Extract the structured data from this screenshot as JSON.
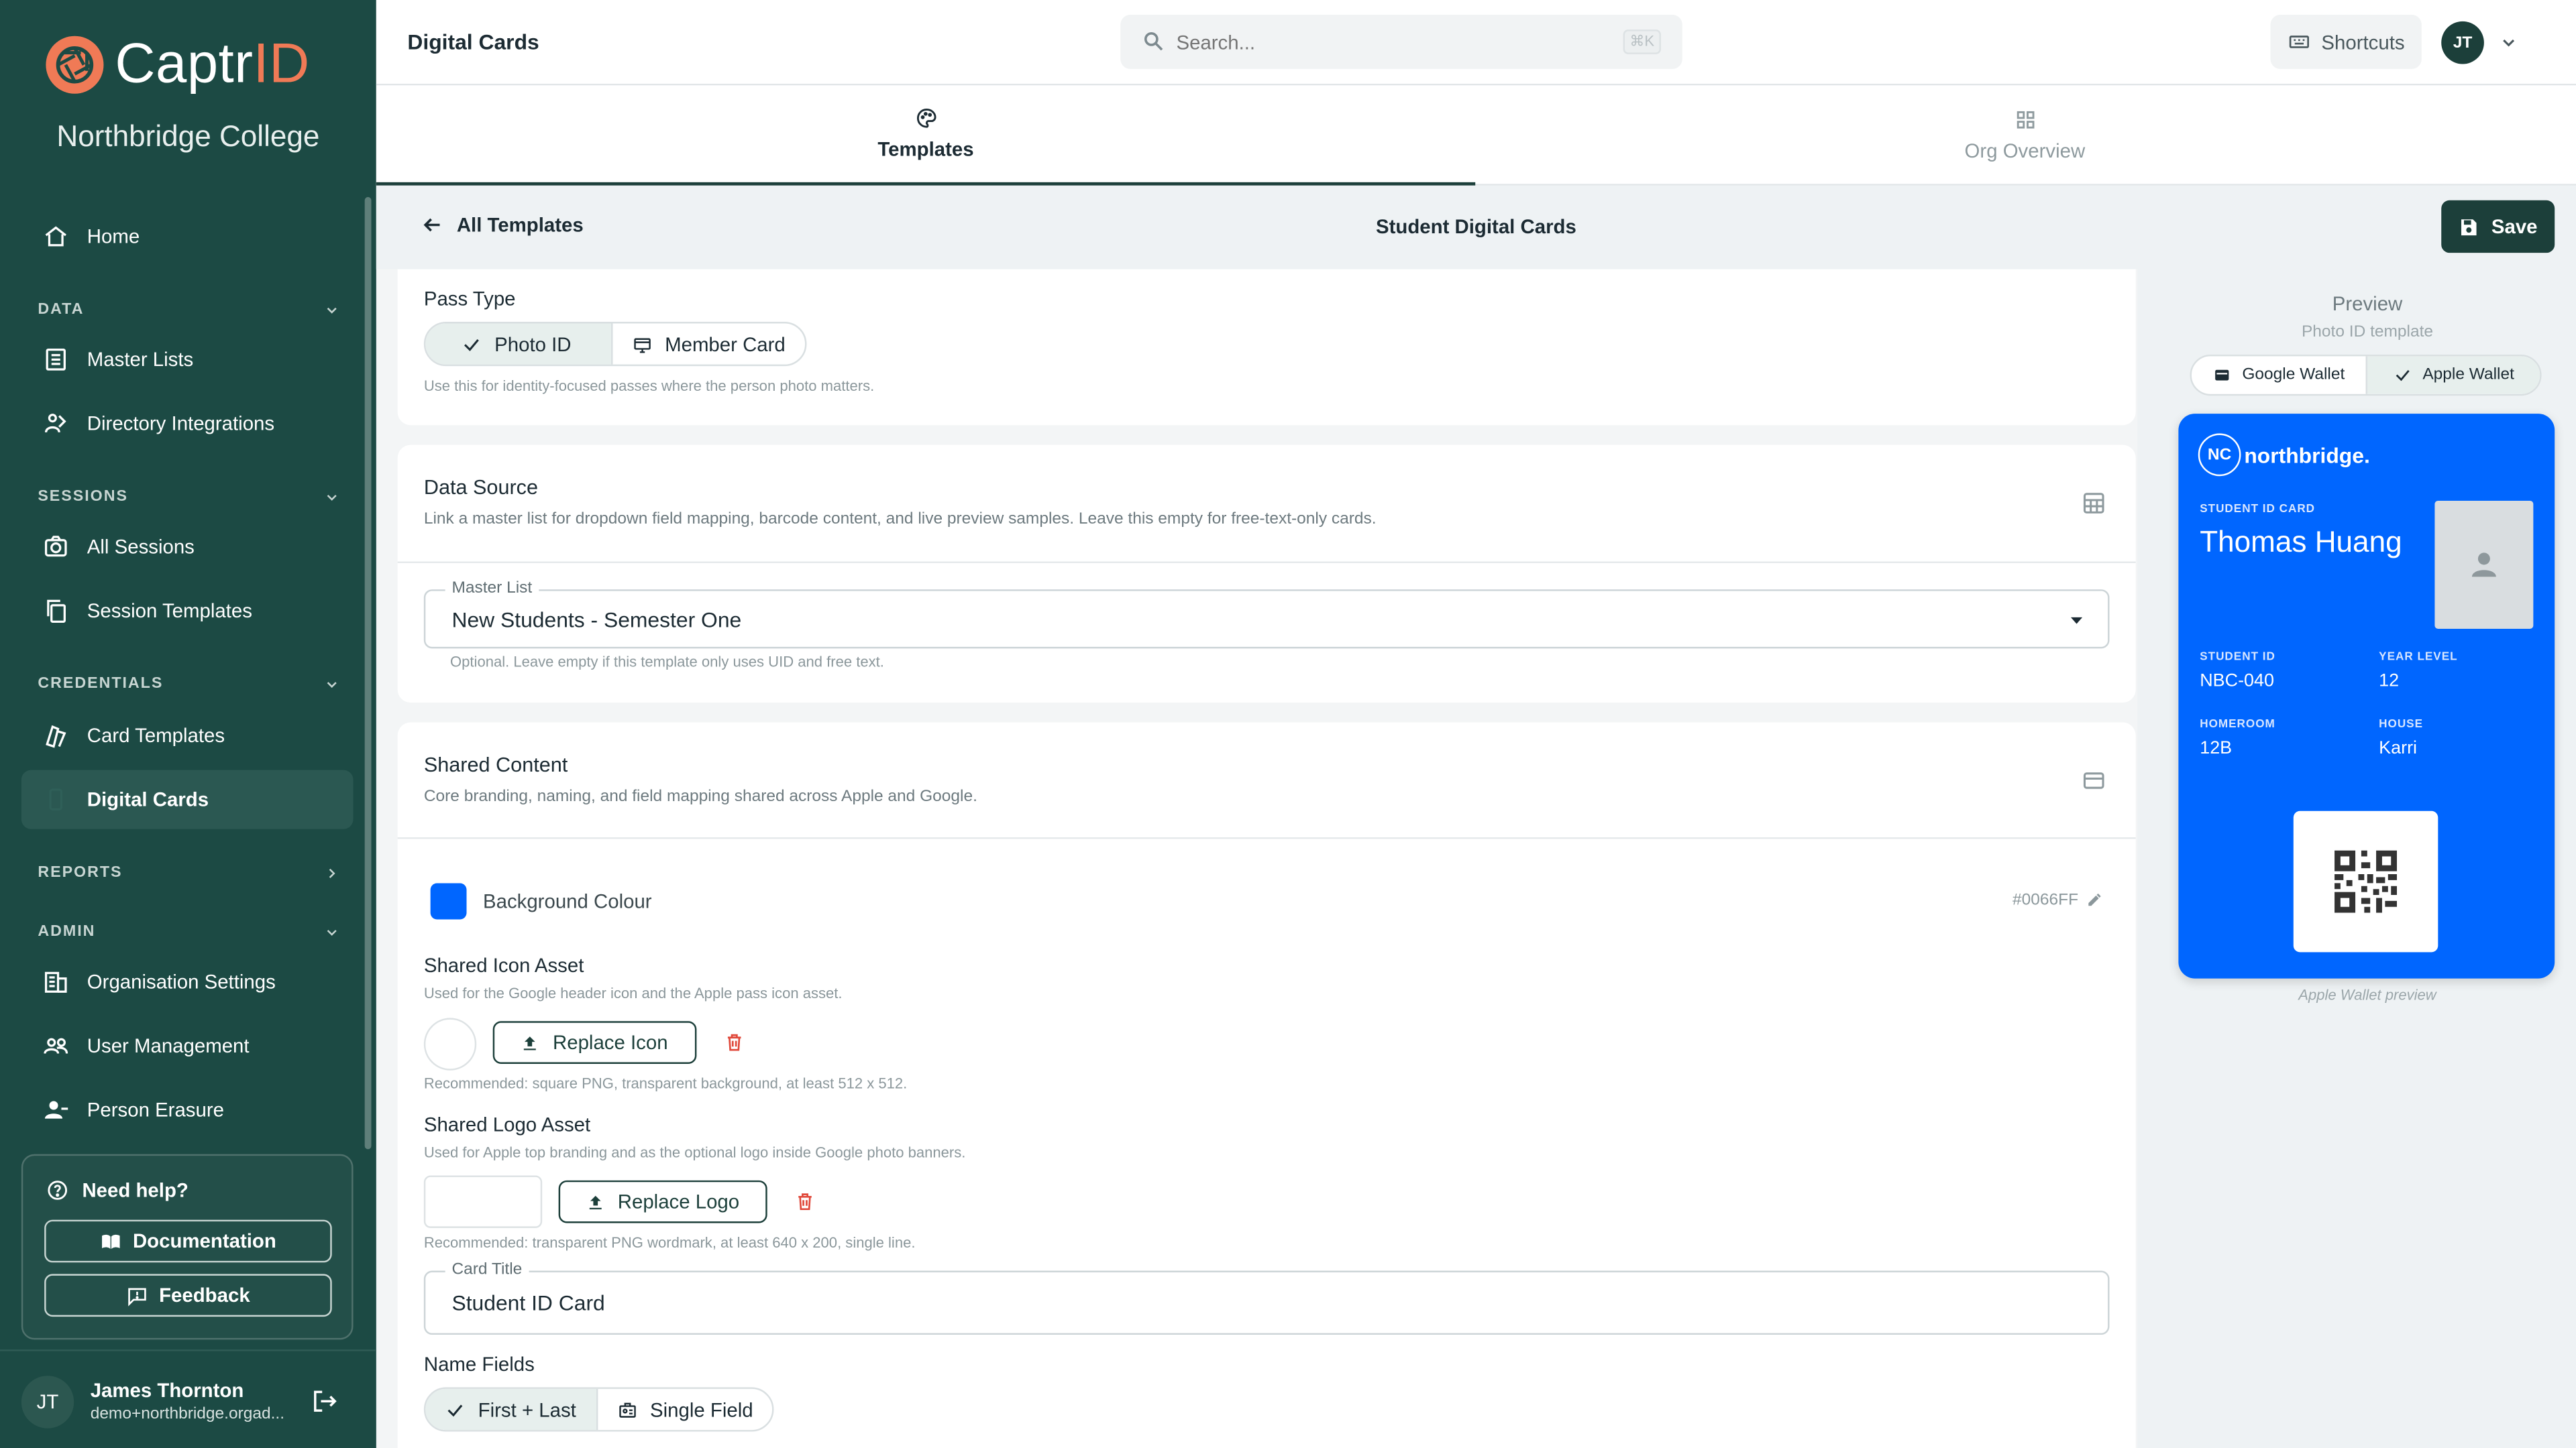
{
  "brand": {
    "logo_captr": "Captr",
    "logo_id": "ID",
    "org_name": "Northbridge College"
  },
  "sidebar": {
    "home": "Home",
    "sections": [
      {
        "label": "DATA"
      },
      {
        "label": "SESSIONS"
      },
      {
        "label": "CREDENTIALS"
      },
      {
        "label": "REPORTS"
      },
      {
        "label": "ADMIN"
      }
    ],
    "items": {
      "master_lists": "Master Lists",
      "directory_integrations": "Directory Integrations",
      "all_sessions": "All Sessions",
      "session_templates": "Session Templates",
      "card_templates": "Card Templates",
      "digital_cards": "Digital Cards",
      "org_settings": "Organisation Settings",
      "user_management": "User Management",
      "person_erasure": "Person Erasure"
    },
    "help": {
      "title": "Need help?",
      "documentation": "Documentation",
      "feedback": "Feedback"
    },
    "user": {
      "initials": "JT",
      "name": "James Thornton",
      "email": "demo+northbridge.orgad..."
    }
  },
  "topbar": {
    "title": "Digital Cards",
    "search_placeholder": "Search...",
    "search_kbd": "⌘K",
    "shortcuts": "Shortcuts",
    "avatar": "JT"
  },
  "tabs": [
    {
      "label": "Templates"
    },
    {
      "label": "Org Overview"
    }
  ],
  "subheader": {
    "back": "All Templates",
    "title": "Student Digital Cards",
    "save": "Save"
  },
  "pass_type": {
    "label": "Pass Type",
    "options": [
      "Photo ID",
      "Member Card"
    ],
    "selected": "Photo ID",
    "help": "Use this for identity-focused passes where the person photo matters."
  },
  "data_source": {
    "title": "Data Source",
    "desc": "Link a master list for dropdown field mapping, barcode content, and live preview samples. Leave this empty for free-text-only cards.",
    "field_label": "Master List",
    "field_value": "New Students - Semester One",
    "help": "Optional. Leave empty if this template only uses UID and free text."
  },
  "shared": {
    "title": "Shared Content",
    "desc": "Core branding, naming, and field mapping shared across Apple and Google.",
    "bg_label": "Background Colour",
    "bg_hex": "#0066FF",
    "bg_color": "#0066ff",
    "icon_title": "Shared Icon Asset",
    "icon_desc": "Used for the Google header icon and the Apple pass icon asset.",
    "icon_btn": "Replace Icon",
    "icon_rec": "Recommended: square PNG, transparent background, at least 512 x 512.",
    "logo_title": "Shared Logo Asset",
    "logo_desc": "Used for Apple top branding and as the optional logo inside Google photo banners.",
    "logo_btn": "Replace Logo",
    "logo_rec": "Recommended: transparent PNG wordmark, at least 640 x 200, single line.",
    "card_title_label": "Card Title",
    "card_title_value": "Student ID Card",
    "name_fields_label": "Name Fields",
    "name_options": [
      "First + Last",
      "Single Field"
    ],
    "name_selected": "First + Last"
  },
  "preview": {
    "title": "Preview",
    "subtitle": "Photo ID template",
    "wallets": [
      "Google Wallet",
      "Apple Wallet"
    ],
    "selected_wallet": "Apple Wallet",
    "caption": "Apple Wallet preview",
    "pass": {
      "logo_mark": "NC",
      "logo_text": "northbridge.",
      "card_label": "STUDENT ID CARD",
      "name": "Thomas Huang",
      "student_id_label": "STUDENT ID",
      "student_id": "NBC-040",
      "year_label": "YEAR LEVEL",
      "year": "12",
      "homeroom_label": "HOMEROOM",
      "homeroom": "12B",
      "house_label": "HOUSE",
      "house": "Karri"
    }
  }
}
